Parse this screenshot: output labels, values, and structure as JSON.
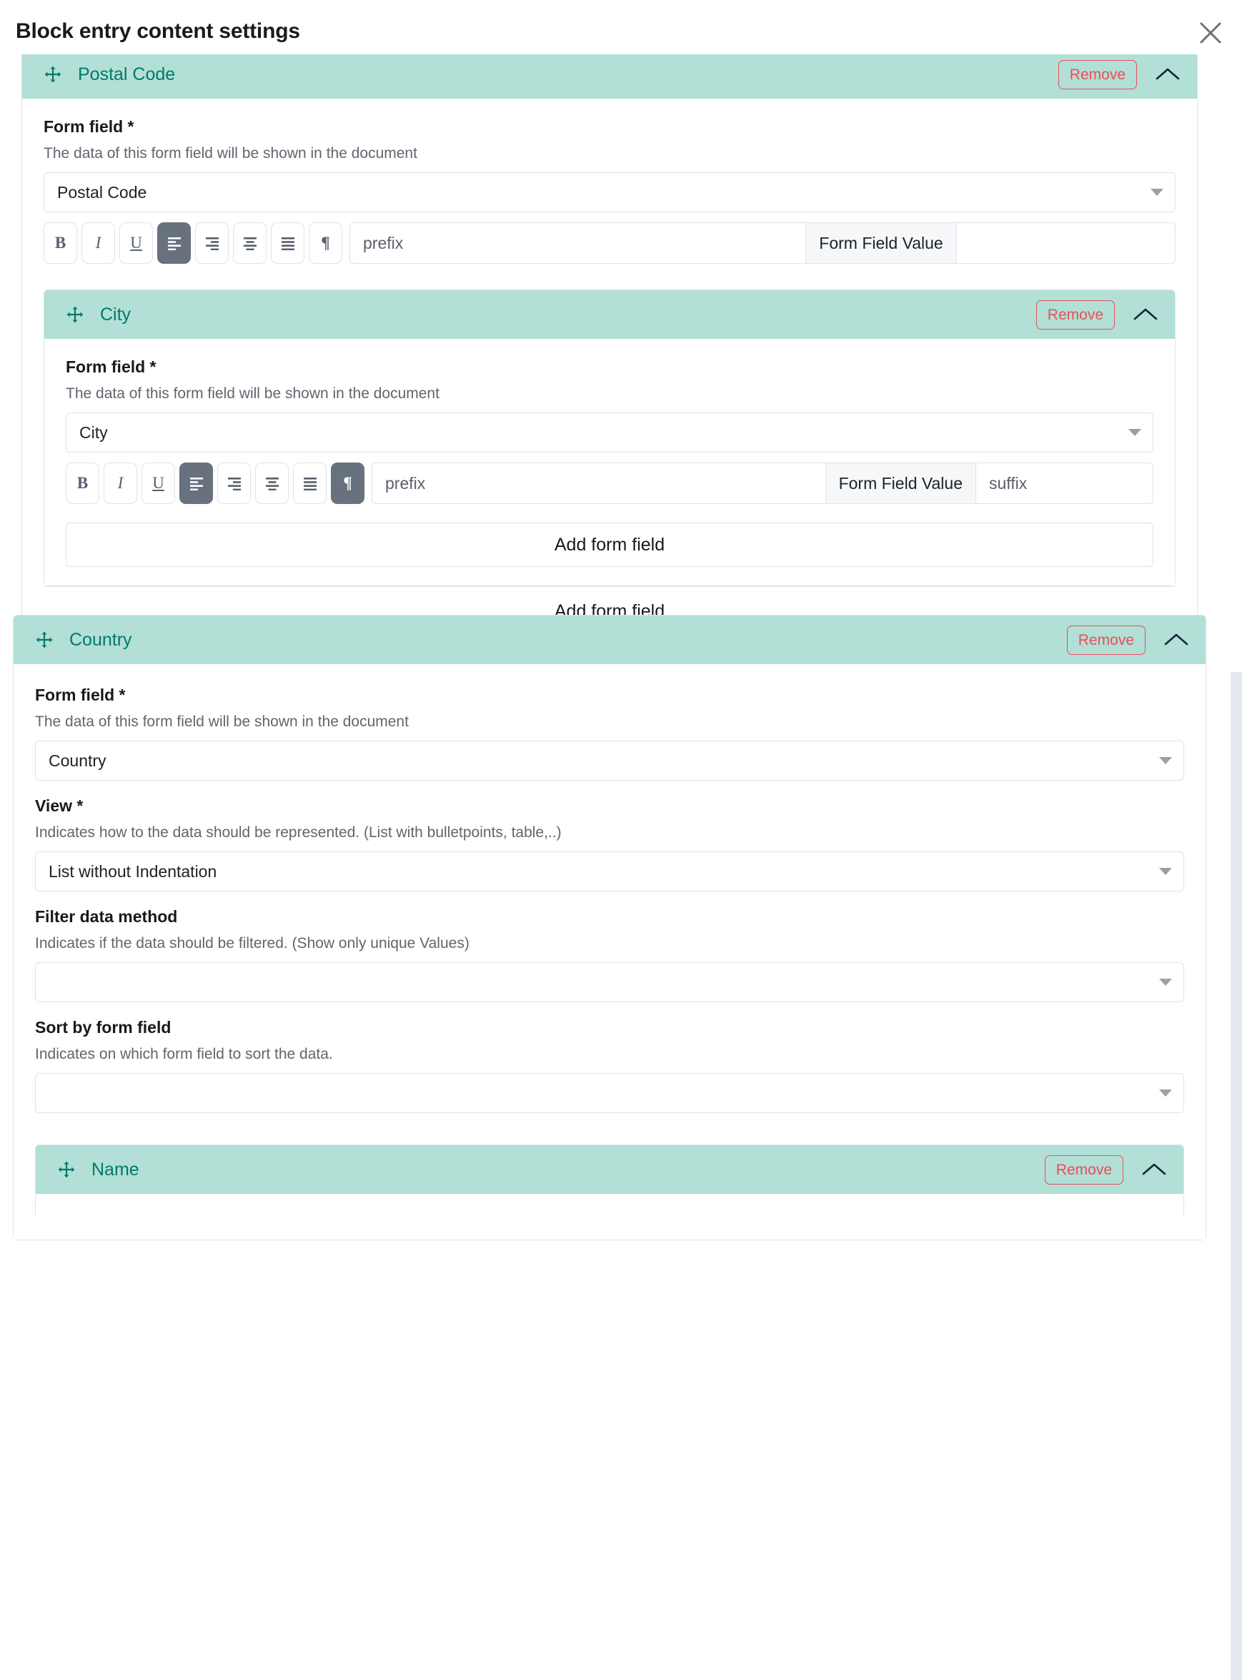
{
  "modal": {
    "title": "Block entry content settings",
    "close_icon": "close-icon"
  },
  "labels": {
    "form_field": "Form field *",
    "form_field_help": "The data of this form field will be shown in the document",
    "view": "View *",
    "view_help": "Indicates how to the data should be represented. (List with bulletpoints, table,..)",
    "filter_method": "Filter data method",
    "filter_method_help": "Indicates if the data should be filtered. (Show only unique Values)",
    "sort_by": "Sort by form field",
    "sort_by_help": "Indicates on which form field to sort the data.",
    "remove": "Remove",
    "add_form_field": "Add form field",
    "form_field_value": "Form Field Value",
    "prefix_placeholder": "prefix",
    "suffix_placeholder": "suffix",
    "empty_select": ""
  },
  "toolbar_icons": {
    "bold": "bold-icon",
    "italic": "italic-icon",
    "underline": "underline-icon",
    "align_left": "align-left-icon",
    "align_right": "align-right-icon",
    "align_center": "align-center-icon",
    "align_justify": "align-justify-icon",
    "paragraph": "pilcrow-icon"
  },
  "colors": {
    "header_teal": "#b2dfd6",
    "title_teal": "#00796b",
    "remove_red": "#e8505b",
    "toolbar_active": "#68717e",
    "border_gray": "#dfe3e8",
    "scrollbar_track": "#e6eaee"
  },
  "blocks": {
    "postal_code": {
      "title": "Postal Code",
      "drag_icon": "drag-move-icon",
      "collapse_icon": "chevron-up-icon",
      "remove_label": "Remove",
      "selected_form_field": "Postal Code",
      "prefix_value": "",
      "suffix_value": "",
      "active_tools": [
        "align_left"
      ]
    },
    "city": {
      "title": "City",
      "drag_icon": "drag-move-icon",
      "collapse_icon": "chevron-up-icon",
      "remove_label": "Remove",
      "selected_form_field": "City",
      "prefix_value": "",
      "suffix_value": "",
      "active_tools": [
        "align_left",
        "paragraph"
      ]
    },
    "country": {
      "title": "Country",
      "drag_icon": "drag-move-icon",
      "collapse_icon": "chevron-up-icon",
      "remove_label": "Remove",
      "selected_form_field": "Country",
      "selected_view": "List without Indentation",
      "selected_filter": "",
      "selected_sort": ""
    },
    "name": {
      "title": "Name",
      "drag_icon": "drag-move-icon",
      "collapse_icon": "chevron-up-icon",
      "remove_label": "Remove"
    }
  },
  "add_buttons": {
    "city_inner": "Add form field",
    "postal_inner": "Add form field",
    "postal_outer": "Add form field"
  }
}
